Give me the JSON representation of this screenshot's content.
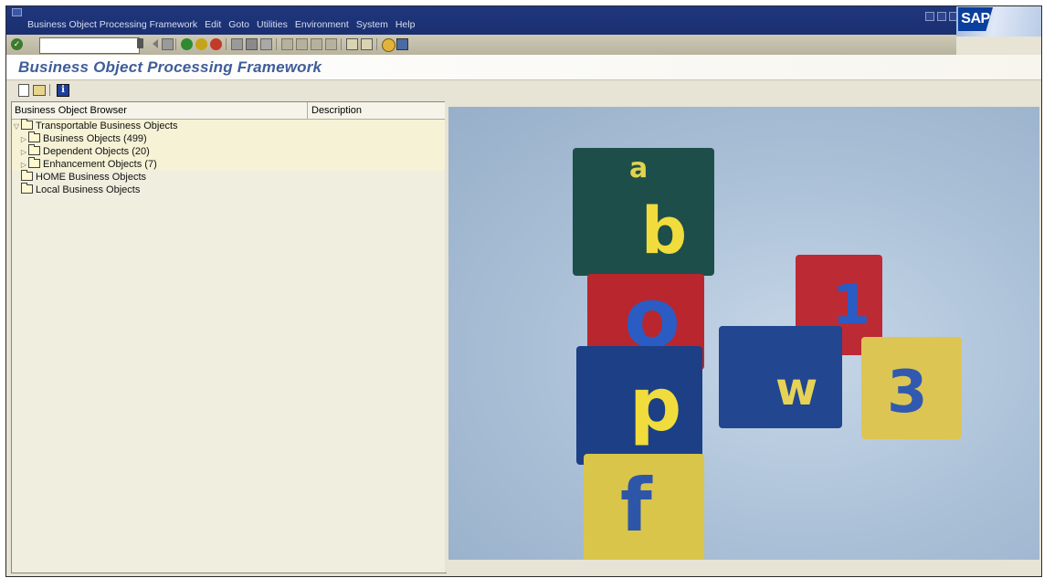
{
  "menubar": {
    "items": [
      "Business Object Processing Framework",
      "Edit",
      "Goto",
      "Utilities",
      "Environment",
      "System",
      "Help"
    ]
  },
  "logo": {
    "text": "SAP"
  },
  "command_field": {
    "value": ""
  },
  "page": {
    "title": "Business Object Processing Framework"
  },
  "tree": {
    "columns": [
      "Business Object Browser",
      "Description"
    ],
    "nodes": [
      {
        "label": "Transportable Business Objects",
        "expanded": true
      },
      {
        "label": "Business Objects (499)",
        "expanded": false
      },
      {
        "label": "Dependent Objects (20)",
        "expanded": false
      },
      {
        "label": "Enhancement Objects (7)",
        "expanded": false
      },
      {
        "label": "HOME Business Objects"
      },
      {
        "label": "Local Business Objects"
      }
    ]
  },
  "image": {
    "letters": [
      "a",
      "b",
      "o",
      "p",
      "f",
      "1",
      "w",
      "3"
    ]
  },
  "colors": {
    "menubar": "#20377e",
    "title": "#3f5d9a",
    "toolbar": "#cfcab6",
    "panel": "#f0eedf"
  }
}
